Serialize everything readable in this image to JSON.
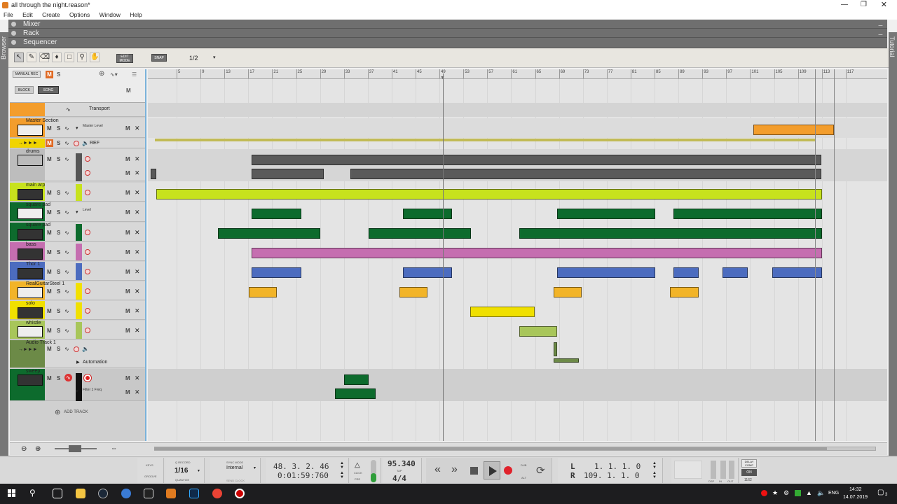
{
  "window": {
    "title": "all through the night.reason*"
  },
  "menu": [
    "File",
    "Edit",
    "Create",
    "Options",
    "Window",
    "Help"
  ],
  "sections": {
    "mixer": "Mixer",
    "rack": "Rack",
    "sequencer": "Sequencer"
  },
  "side_tabs": {
    "browser": "Browser",
    "tutorial": "Tutorial"
  },
  "toolbar": {
    "edit_mode": "EDIT MODE",
    "snap": "SNAP",
    "snap_value": "1/2"
  },
  "panel_head": {
    "manual_rec": "MANUAL REC",
    "block": "BLOCK",
    "song": "SONG",
    "m": "M",
    "s": "S"
  },
  "tracks": [
    {
      "name": "Transport",
      "color": "#f39d2c"
    },
    {
      "name": "Master Section",
      "color": "#f39d2c",
      "lane": "Master Level"
    },
    {
      "name": "REF",
      "color": "#f0d400"
    },
    {
      "name": "drums",
      "color": "#bdbdbd"
    },
    {
      "name": "main arp",
      "color": "#c7e21d"
    },
    {
      "name": "square pad",
      "color": "#0d6b2d",
      "lane": "Level"
    },
    {
      "name": "square pad",
      "color": "#0d6b2d"
    },
    {
      "name": "bass",
      "color": "#c56eb0"
    },
    {
      "name": "Thor 1",
      "color": "#4c6cbf"
    },
    {
      "name": "RealGuitarSteel 1",
      "color": "#f2b428"
    },
    {
      "name": "solo",
      "color": "#f0e000"
    },
    {
      "name": "whistle",
      "color": "#a8c65a"
    },
    {
      "name": "Audio Track 1",
      "color": "#6c8a47",
      "lane": "Automation"
    },
    {
      "name": "sweep",
      "color": "#0d6b2d",
      "lane": "Filter 1 Freq"
    }
  ],
  "add_track": "ADD TRACK",
  "ruler_bars": [
    "5",
    "9",
    "13",
    "17",
    "21",
    "25",
    "29",
    "33",
    "37",
    "41",
    "45",
    "49",
    "53",
    "57",
    "61",
    "65",
    "69",
    "73",
    "77",
    "81",
    "85",
    "89",
    "93",
    "97",
    "101",
    "105",
    "109",
    "113",
    "117"
  ],
  "transport": {
    "keys": "KEYS",
    "groove": "GROOVE",
    "q_record": "Q RECORD",
    "quantize_value": "1/16",
    "quantize": "QUANTIZE",
    "sync_mode": "SYNC MODE",
    "sync_value": "Internal",
    "send_clock": "SEND CLOCK",
    "position_bars": "48.  3.  2.  46",
    "position_time": "0:01:59:760",
    "click": "CLICK",
    "pre": "PRE",
    "tempo": "95.340",
    "tap": "TAP",
    "signature": "4/4",
    "dub": "DUB",
    "alt": "ALT",
    "loop_left_label": "L",
    "loop_left": "1.  1.  1.    0",
    "loop_right_label": "R",
    "loop_right": "109.  1.  1.    0",
    "dsp": "DSP",
    "in": "IN",
    "out": "OUT",
    "delay_comp": "DELAY COMP",
    "delay_on": "ON",
    "delay_value": "1162"
  },
  "taskbar": {
    "lang": "ENG",
    "time": "14:32",
    "date": "14.07.2019",
    "notifications": "3"
  }
}
